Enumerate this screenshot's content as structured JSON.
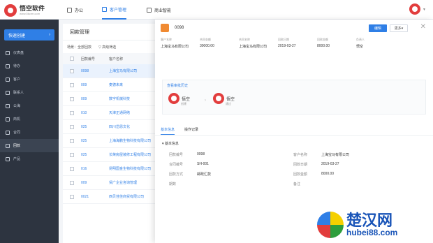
{
  "topbar": {
    "logo_title": "悟空软件",
    "logo_sub": "www.5kcrm.com",
    "nav": [
      {
        "label": "办公",
        "icon": "office-icon"
      },
      {
        "label": "客户管理",
        "icon": "customer-icon"
      },
      {
        "label": "商业智能",
        "icon": "chart-icon"
      }
    ]
  },
  "sidebar": {
    "quick_create": "快速创建",
    "items": [
      {
        "label": "仪表盘",
        "icon": "dashboard-icon"
      },
      {
        "label": "待办",
        "icon": "todo-icon"
      },
      {
        "label": "客户",
        "icon": "customer-icon"
      },
      {
        "label": "联系人",
        "icon": "contact-icon"
      },
      {
        "label": "公海",
        "icon": "pool-icon"
      },
      {
        "label": "商机",
        "icon": "opportunity-icon"
      },
      {
        "label": "合同",
        "icon": "contract-icon"
      },
      {
        "label": "回款",
        "icon": "payment-icon"
      },
      {
        "label": "产品",
        "icon": "product-icon"
      }
    ]
  },
  "main": {
    "title": "回款管理",
    "filter_label": "场景：全部回款",
    "advanced_filter": "高级筛选",
    "columns": [
      "回款编号",
      "客户名称"
    ],
    "rows": [
      [
        "0098",
        "上海宝马有限公司"
      ],
      [
        "009",
        "麦德未来"
      ],
      [
        "009",
        "数字机械科技"
      ],
      [
        "010",
        "天津正通网络"
      ],
      [
        "025",
        "四川岱恩文化"
      ],
      [
        "025",
        "上海海鹏生物科技有限公司"
      ],
      [
        "025",
        "长荣房屋装修工程有限公司"
      ],
      [
        "016",
        "昆明国金生物科技有限公司"
      ],
      [
        "009",
        "贸广企业咨询管理"
      ],
      [
        "0021",
        "西贝佳佳商贸有限公司"
      ]
    ]
  },
  "drawer": {
    "title": "0098",
    "edit_button": "编辑",
    "more_button": "更多",
    "summary": [
      {
        "label": "客户名称",
        "value": "上海宝马有限公司"
      },
      {
        "label": "合同金额",
        "value": "30000.00"
      },
      {
        "label": "合同名称",
        "value": "上海宝马有限公司"
      },
      {
        "label": "回款日期",
        "value": "2019-03-27"
      },
      {
        "label": "回款金额",
        "value": "8000.00"
      },
      {
        "label": "负责人",
        "value": "悟空"
      }
    ],
    "flow_title": "查看审批历史",
    "steps": [
      {
        "name": "悟空",
        "status": "创建"
      },
      {
        "name": "悟空",
        "status": "通过"
      }
    ],
    "tabs": [
      "基本信息",
      "操作记录"
    ],
    "section_title": "基本信息",
    "details": [
      {
        "label": "回款编号",
        "value": "0098"
      },
      {
        "label": "客户名称",
        "value": "上海宝马有限公司"
      },
      {
        "label": "合同编号",
        "value": "SH-001"
      },
      {
        "label": "回款日期",
        "value": "2019-03-27"
      },
      {
        "label": "回款方式",
        "value": "邮政汇款"
      },
      {
        "label": "回款金额",
        "value": "8000.00"
      },
      {
        "label": "期数",
        "value": ""
      },
      {
        "label": "备注",
        "value": ""
      }
    ]
  },
  "watermark": {
    "cn": "楚汉网",
    "en": "hubei88.com"
  }
}
